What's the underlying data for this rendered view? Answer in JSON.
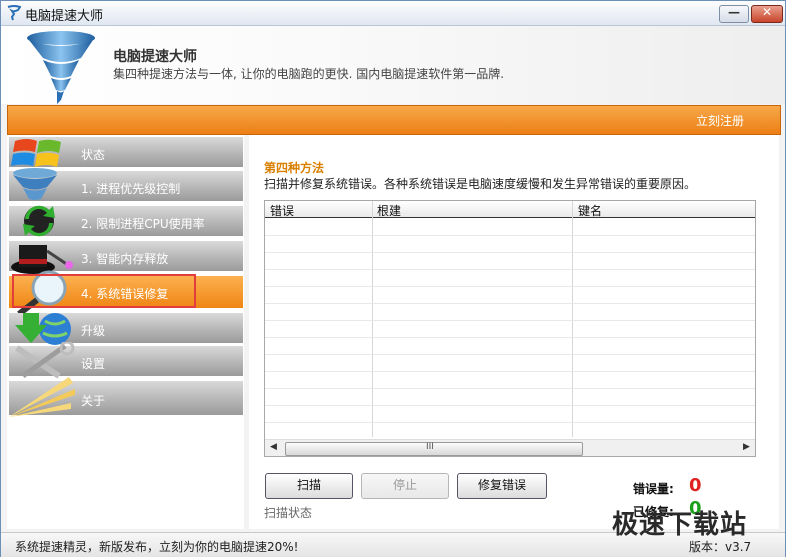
{
  "window": {
    "title": "电脑提速大师",
    "minimize_glyph": "—",
    "close_glyph": "✕"
  },
  "header": {
    "app_name": "电脑提速大师",
    "slogan": "集四种提速方法与一体, 让你的电脑跑的更快. 国内电脑提速软件第一品牌."
  },
  "topbar": {
    "register": "立刻注册"
  },
  "sidebar": {
    "items": [
      {
        "label": "状态",
        "icon": "windows-logo-icon"
      },
      {
        "label": "1. 进程优先级控制",
        "icon": "tornado-icon"
      },
      {
        "label": "2. 限制进程CPU使用率",
        "icon": "refresh-arrows-icon"
      },
      {
        "label": "3. 智能内存释放",
        "icon": "magic-hat-icon"
      },
      {
        "label": "4. 系统错误修复",
        "icon": "magnifier-icon",
        "active": true
      },
      {
        "label": "升级",
        "icon": "globe-download-icon"
      },
      {
        "label": "设置",
        "icon": "tools-icon"
      },
      {
        "label": "关于",
        "icon": "light-rays-icon"
      }
    ]
  },
  "main": {
    "method_title": "第四种方法",
    "description": "扫描并修复系统错误。各种系统错误是电脑速度缓慢和发生异常错误的重要原因。",
    "columns": [
      "错误",
      "根建",
      "键名"
    ],
    "scroll_grip": "III",
    "buttons": {
      "scan": "扫描",
      "stop": "停止",
      "fix": "修复错误"
    },
    "scan_status": "扫描状态",
    "errors_label": "错误量:",
    "errors_value": "0",
    "fixed_label": "已修复:",
    "fixed_value": "0"
  },
  "statusbar": {
    "promo": "系统提速精灵，新版发布，立刻为你的电脑提速20%!",
    "version": "版本：v3.7"
  },
  "watermark": "极速下载站",
  "colors": {
    "accent_orange": "#ef8514",
    "error_red": "#e02020",
    "fixed_green": "#1aa01a"
  }
}
